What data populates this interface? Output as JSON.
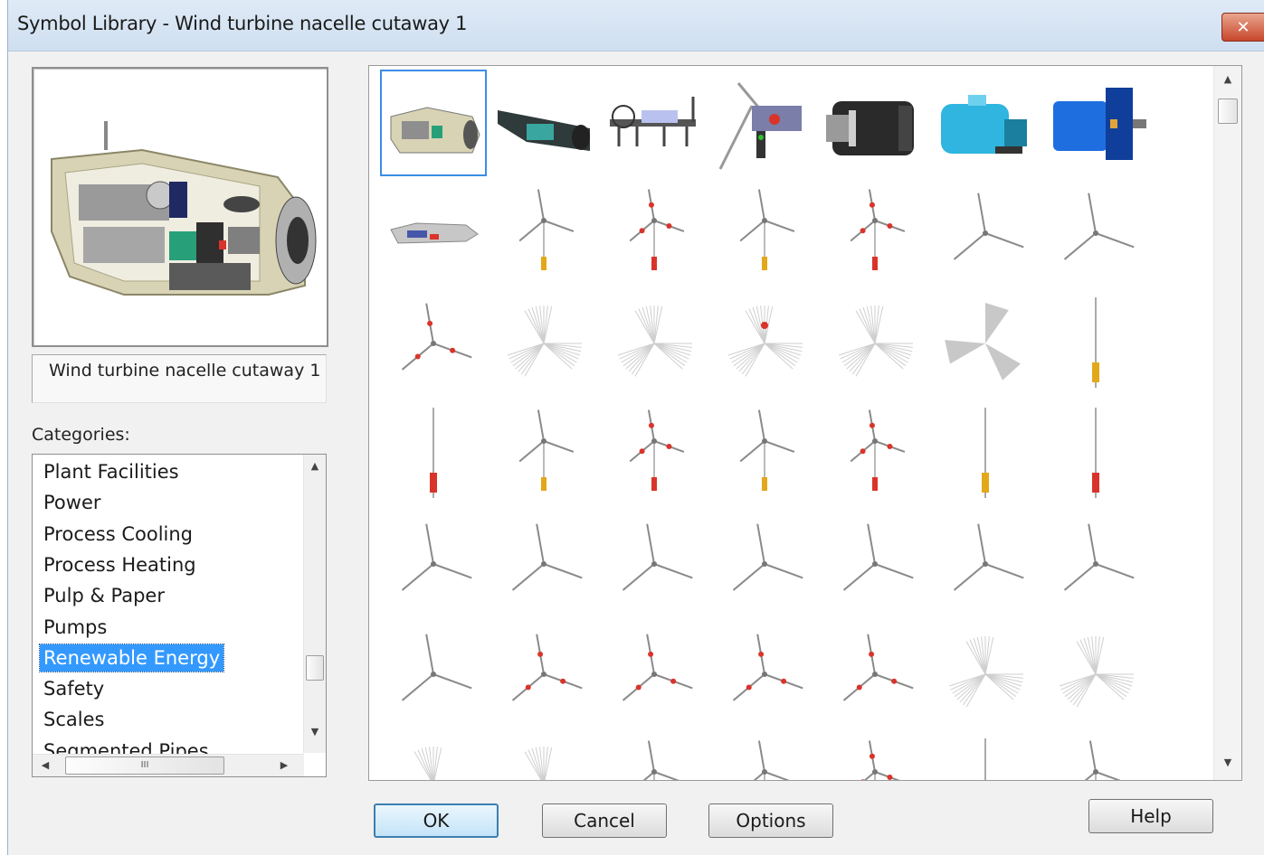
{
  "window": {
    "title": "Symbol Library - Wind turbine nacelle cutaway 1",
    "close_glyph": "✕"
  },
  "preview": {
    "selected_name": "Wind turbine nacelle cutaway 1",
    "image_icon": "nacelle-cutaway-icon"
  },
  "categories": {
    "label": "Categories:",
    "items": [
      {
        "label": "Plant Facilities",
        "selected": false
      },
      {
        "label": "Power",
        "selected": false
      },
      {
        "label": "Process Cooling",
        "selected": false
      },
      {
        "label": "Process Heating",
        "selected": false
      },
      {
        "label": "Pulp & Paper",
        "selected": false
      },
      {
        "label": "Pumps",
        "selected": false
      },
      {
        "label": "Renewable Energy",
        "selected": true
      },
      {
        "label": "Safety",
        "selected": false
      },
      {
        "label": "Scales",
        "selected": false
      },
      {
        "label": "Segmented Pipes",
        "selected": false
      }
    ],
    "scroll_up": "▲",
    "scroll_down": "▼",
    "scroll_left": "◀",
    "scroll_right": "▶",
    "h_thumb_grip": "III"
  },
  "gallery": {
    "scroll_up": "▲",
    "scroll_down": "▼",
    "symbols": [
      [
        "nacelle-cutaway-icon",
        "nacelle-teal-icon",
        "drivetrain-frame-icon",
        "rotor-hub-assembly-icon",
        "generator-dark-icon",
        "motor-cyan-icon",
        "motor-blue-icon"
      ],
      [
        "drivetrain-small-icon",
        "wind-turbine-yellow-icon",
        "wind-turbine-red-icon",
        "wind-turbine-yellow-icon",
        "wind-turbine-red-icon",
        "rotor-gray-icon",
        "rotor-gray-icon"
      ],
      [
        "rotor-red-icon",
        "rotor-spinning-icon",
        "rotor-spinning-icon",
        "rotor-spinning-red-icon",
        "rotor-spinning-icon",
        "rotor-solid-blades-icon",
        "tower-yellow-icon"
      ],
      [
        "tower-red-icon",
        "wind-turbine-yellow-icon",
        "wind-turbine-red-icon",
        "wind-turbine-yellow-icon",
        "wind-turbine-red-icon",
        "tower-yellow-icon",
        "tower-red-icon"
      ],
      [
        "rotor-gray-icon",
        "rotor-gray-icon",
        "rotor-gray-icon",
        "rotor-gray-icon",
        "rotor-gray-icon",
        "rotor-gray-icon",
        "rotor-gray-icon"
      ],
      [
        "rotor-gray-icon",
        "rotor-red-icon",
        "rotor-red-icon",
        "rotor-red-icon",
        "rotor-red-icon",
        "rotor-spinning-icon",
        "rotor-spinning-icon"
      ],
      [
        "rotor-spinning-icon",
        "rotor-spinning-icon",
        "wind-turbine-gray-icon",
        "wind-turbine-gray-icon",
        "wind-turbine-red-icon",
        "tower-gray-icon",
        "wind-turbine-gray-icon"
      ]
    ]
  },
  "buttons": {
    "ok": "OK",
    "cancel": "Cancel",
    "options": "Options",
    "help": "Help"
  },
  "colors": {
    "selection": "#3399ff",
    "accent_red": "#d9342b",
    "accent_yellow": "#e3a81a"
  }
}
